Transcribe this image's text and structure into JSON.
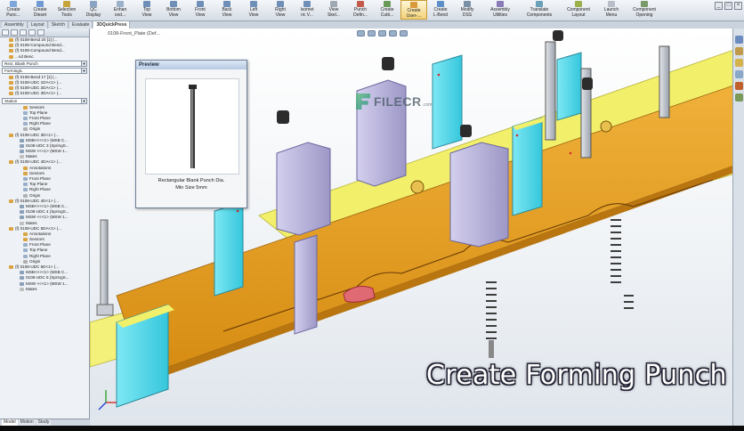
{
  "ribbon": {
    "buttons": [
      {
        "label": "Create\nPunc...",
        "color": "#7ea6d8"
      },
      {
        "label": "Create\nDieset",
        "color": "#6f9ad2"
      },
      {
        "label": "Selection\nTools",
        "color": "#c7a43a"
      },
      {
        "label": "QC\nDisplay",
        "color": "#8aa4c4"
      },
      {
        "label": "Enhan\nced...",
        "color": "#9bb0c9"
      },
      {
        "label": "Top\nView",
        "color": "#6f8fb8"
      },
      {
        "label": "Bottom\nView",
        "color": "#6f8fb8"
      },
      {
        "label": "Front\nView",
        "color": "#6f8fb8"
      },
      {
        "label": "Back\nView",
        "color": "#6f8fb8"
      },
      {
        "label": "Left\nView",
        "color": "#6f8fb8"
      },
      {
        "label": "Right\nView",
        "color": "#6f8fb8"
      },
      {
        "label": "Isomet\nric V...",
        "color": "#6f8fb8"
      },
      {
        "label": "View\nSkel...",
        "color": "#a0a8b4"
      },
      {
        "label": "Punch\nDefin...",
        "color": "#c45a4a"
      },
      {
        "label": "Create\nCutti...",
        "color": "#6a9a5a"
      },
      {
        "label": "Create\nUser-...",
        "color": "#d89a3a",
        "active": true
      },
      {
        "label": "Create\nL-Bend",
        "color": "#5f8fc8"
      },
      {
        "label": "Modify\nDSS",
        "color": "#7a8fa8"
      },
      {
        "label": "Assembly\nUtilities",
        "color": "#8a7ab8"
      },
      {
        "label": "Translate\nComponents",
        "color": "#6aa0b8"
      },
      {
        "label": "Component\nLayout",
        "color": "#9ab04a"
      },
      {
        "label": "Launch\nMenu",
        "color": "#b8bec8"
      },
      {
        "label": "Component\nOpening",
        "color": "#7a9a6a"
      }
    ],
    "window_controls": [
      "_",
      "□",
      "×"
    ]
  },
  "tabs": [
    {
      "label": "Assembly",
      "active": false
    },
    {
      "label": "Layout",
      "active": false
    },
    {
      "label": "Sketch",
      "active": false
    },
    {
      "label": "Evaluate",
      "active": false
    },
    {
      "label": "3DQuickPress",
      "active": true
    }
  ],
  "feature_tree": {
    "rows_top": [
      {
        "label": "(f) 0108-Bend 20 [1] (...",
        "color": "#d9a441"
      },
      {
        "label": "(f) 0108-Compound Bend...",
        "color": "#d9a441"
      },
      {
        "label": "(f) 0108-Compound Bend...",
        "color": "#d9a441"
      },
      {
        "label": "...nd Benc",
        "color": "#d9a441"
      }
    ],
    "field_punch": "Rect. Blank Punch",
    "field_forming": "Forming/L",
    "rows_mid": [
      {
        "label": "(f) 0108-Bend 17 [1] (...",
        "color": "#d9a441"
      },
      {
        "label": "(f) 0108-UDC 1DA<1> (...",
        "color": "#d9a441"
      },
      {
        "label": "(f) 0108-UDC 2DA<1> (...",
        "color": "#d9a441"
      },
      {
        "label": "(f) 0108-UDC 3DA<1> (...",
        "color": "#d9a441"
      }
    ],
    "field_station": "Station",
    "rows_station": [
      {
        "label": "Sensors",
        "color": "#d9a441"
      },
      {
        "label": "Top Plane",
        "color": "#9ab0c8"
      },
      {
        "label": "Front Plane",
        "color": "#9ab0c8"
      },
      {
        "label": "Right Plane",
        "color": "#9ab0c8"
      },
      {
        "label": "Origin",
        "color": "#b0b0b0"
      },
      {
        "label": "(f) 0108-UDC 3D<1> (...",
        "color": "#d9a441"
      },
      {
        "label": "MSB<<<<1> (MSB C...",
        "color": "#8aa0b8"
      },
      {
        "label": "0108-UDC 3 (SpringS...",
        "color": "#8aa0b8"
      },
      {
        "label": "MSW <<<1> (MSW 1...",
        "color": "#8aa0b8"
      },
      {
        "label": "Mates",
        "color": "#c0c0c0"
      },
      {
        "label": "(f) 0108-UDC 4DA<1> (...",
        "color": "#d9a441"
      },
      {
        "label": "Annotations",
        "color": "#d9a441"
      },
      {
        "label": "Sensors",
        "color": "#d9a441"
      },
      {
        "label": "Front Plane",
        "color": "#9ab0c8"
      },
      {
        "label": "Top Plane",
        "color": "#9ab0c8"
      },
      {
        "label": "Right Plane",
        "color": "#9ab0c8"
      },
      {
        "label": "Origin",
        "color": "#b0b0b0"
      },
      {
        "label": "(f) 0108-UDC 4D<1> (...",
        "color": "#d9a441"
      },
      {
        "label": "MSB<<<<1> (MSB C...",
        "color": "#8aa0b8"
      },
      {
        "label": "0108-UDC 4 (SpringS...",
        "color": "#8aa0b8"
      },
      {
        "label": "MSW <<<1> (MSW 1...",
        "color": "#8aa0b8"
      },
      {
        "label": "Mates",
        "color": "#c0c0c0"
      },
      {
        "label": "(f) 0108-UDC 5DA<1> (...",
        "color": "#d9a441"
      },
      {
        "label": "Annotations",
        "color": "#d9a441"
      },
      {
        "label": "Sensors",
        "color": "#d9a441"
      },
      {
        "label": "Front Plane",
        "color": "#9ab0c8"
      },
      {
        "label": "Top Plane",
        "color": "#9ab0c8"
      },
      {
        "label": "Right Plane",
        "color": "#9ab0c8"
      },
      {
        "label": "Origin",
        "color": "#b0b0b0"
      },
      {
        "label": "(f) 0108-UDC 5D<1> (...",
        "color": "#d9a441"
      },
      {
        "label": "MSB<<<<1> (MSB C...",
        "color": "#8aa0b8"
      },
      {
        "label": "0108-UDC 5 (SpringS...",
        "color": "#8aa0b8"
      },
      {
        "label": "MSW <<<1> (MSW 1...",
        "color": "#8aa0b8"
      },
      {
        "label": "Mates",
        "color": "#c0c0c0"
      }
    ]
  },
  "bottom_tabs": [
    {
      "label": "Model",
      "active": true
    },
    {
      "label": "Motion",
      "active": false
    },
    {
      "label": "Study",
      "active": false
    }
  ],
  "viewport": {
    "breadcrumb": "0108-Front_Plate (Def..."
  },
  "preview": {
    "title": "Preview",
    "caption_line1": "Rectangular Blank Punch Dia.",
    "caption_line2": "Min Size 5mm"
  },
  "watermark": {
    "text": "FILECR",
    "suffix": ".com"
  },
  "caption": "Create Forming Punch",
  "colors": {
    "strip": "#e6a11c",
    "punch_cyan": "#4fd8ea",
    "punch_lavender": "#b9b4dc",
    "die_plate": "#f2ef6a",
    "bolt": "#2c2c2c",
    "spring": "#6b6b6b",
    "highlight_red": "#e06a73"
  }
}
